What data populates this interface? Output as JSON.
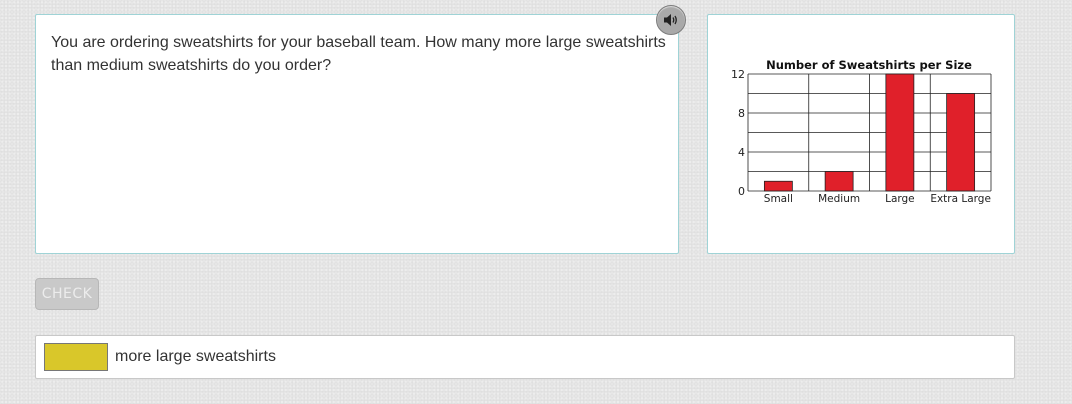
{
  "question": {
    "text": "You are ordering sweatshirts for your baseball team. How many more large sweatshirts than medium sweatshirts do you order?"
  },
  "audio_icon": "speaker-icon",
  "check_label": "CHECK",
  "answer": {
    "value": "",
    "suffix": "more large sweatshirts"
  },
  "colors": {
    "panel_border": "#9fd3d6",
    "bar": "#e0202a",
    "answer_fill": "#d9c72a"
  },
  "chart_data": {
    "type": "bar",
    "title": "Number of Sweatshirts per Size",
    "categories": [
      "Small",
      "Medium",
      "Large",
      "Extra Large"
    ],
    "values": [
      1,
      2,
      12,
      10
    ],
    "ylim": [
      0,
      12
    ],
    "yticks": [
      0,
      4,
      8,
      12
    ],
    "xlabel": "",
    "ylabel": "",
    "grid": true,
    "legend": "none",
    "bar_color": "#e0202a"
  }
}
